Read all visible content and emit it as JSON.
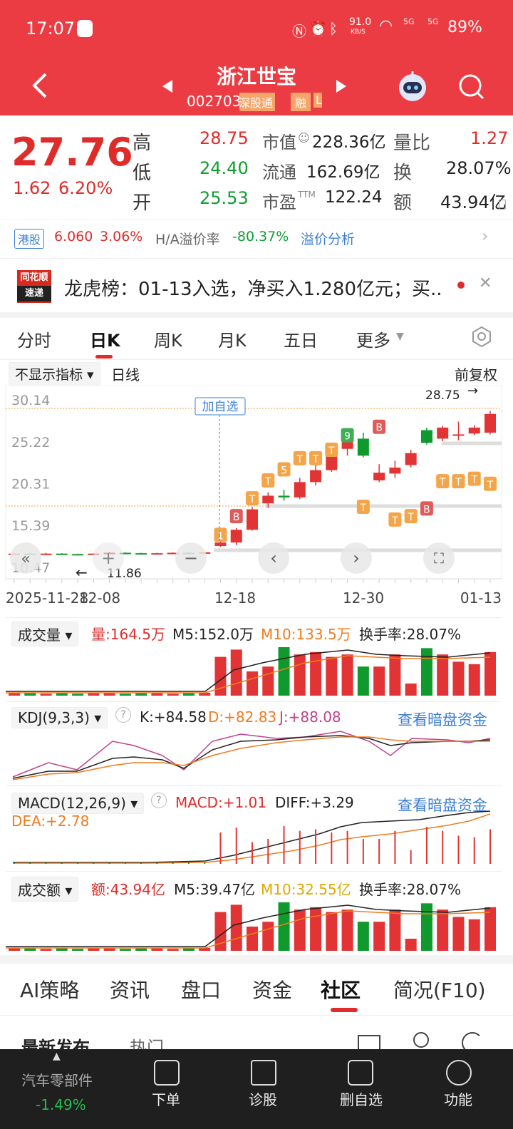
{
  "status": {
    "time": "17:07",
    "speed": "91.0",
    "speed_unit": "KB/S",
    "signal1": "5G",
    "signal2": "5G",
    "battery": "89%"
  },
  "header": {
    "title": "浙江世宝",
    "code": "002703",
    "badge1": "深股通",
    "badge2": "融",
    "badge3": "L"
  },
  "quote": {
    "price": "27.76",
    "change": "1.62",
    "pct": "6.20%",
    "high_label": "高",
    "high": "28.75",
    "low_label": "低",
    "low": "24.40",
    "open_label": "开",
    "open": "25.53",
    "mcap_label": "市值",
    "mcap": "228.36亿",
    "float_label": "流通",
    "float": "162.69亿",
    "pe_label": "市盈",
    "pe_sup": "TTM",
    "pe": "122.24",
    "vr_label": "量比",
    "vr": "1.27",
    "turn_label": "换",
    "turn": "28.07%",
    "amt_label": "额",
    "amt": "43.94亿"
  },
  "hk": {
    "tag": "港股",
    "price": "6.060",
    "pct": "3.06%",
    "premium_label": "H/A溢价率",
    "premium": "-80.37%",
    "link": "溢价分析"
  },
  "news": {
    "logo1": "同花顺",
    "logo2": "速递",
    "text": "龙虎榜：01-13入选，净买入1.280亿元；买..."
  },
  "tabs": [
    "分时",
    "日K",
    "周K",
    "月K",
    "五日",
    "更多"
  ],
  "chart_header": {
    "indicator": "不显示指标",
    "period": "日线",
    "adjust": "前复权"
  },
  "kline": {
    "y_ticks": [
      "30.14",
      "25.22",
      "20.31",
      "15.39",
      "10.47"
    ],
    "x_ticks": [
      "2025-11-28",
      "12-08",
      "12-18",
      "12-30",
      "01-13"
    ],
    "high_mark": "28.75",
    "low_mark": "11.86",
    "add_watch": "加自选"
  },
  "chart_data": {
    "type": "candlestick",
    "candles": [
      {
        "o": 11.9,
        "c": 12.0,
        "h": 12.1,
        "l": 11.9
      },
      {
        "o": 12.0,
        "c": 11.95,
        "h": 12.1,
        "l": 11.86
      },
      {
        "o": 11.95,
        "c": 12.0,
        "h": 12.1,
        "l": 11.9
      },
      {
        "o": 12.0,
        "c": 11.95,
        "h": 12.05,
        "l": 11.9
      },
      {
        "o": 11.95,
        "c": 11.9,
        "h": 12.0,
        "l": 11.86
      },
      {
        "o": 11.9,
        "c": 12.0,
        "h": 12.05,
        "l": 11.9
      },
      {
        "o": 12.0,
        "c": 12.1,
        "h": 12.2,
        "l": 11.95
      },
      {
        "o": 12.1,
        "c": 12.05,
        "h": 12.15,
        "l": 12.0
      },
      {
        "o": 12.05,
        "c": 12.0,
        "h": 12.1,
        "l": 11.95
      },
      {
        "o": 12.0,
        "c": 12.05,
        "h": 12.1,
        "l": 11.95
      },
      {
        "o": 12.05,
        "c": 12.1,
        "h": 12.15,
        "l": 12.0
      },
      {
        "o": 12.1,
        "c": 12.05,
        "h": 12.2,
        "l": 12.0
      },
      {
        "o": 12.05,
        "c": 12.15,
        "h": 12.2,
        "l": 12.0
      },
      {
        "o": 12.9,
        "c": 13.3,
        "h": 13.6,
        "l": 12.8
      },
      {
        "o": 13.3,
        "c": 14.8,
        "h": 15.0,
        "l": 13.0
      },
      {
        "o": 14.8,
        "c": 17.2,
        "h": 17.5,
        "l": 14.7
      },
      {
        "o": 17.9,
        "c": 18.8,
        "h": 19.2,
        "l": 17.4
      },
      {
        "o": 18.8,
        "c": 18.6,
        "h": 19.5,
        "l": 18.2
      },
      {
        "o": 18.6,
        "c": 20.4,
        "h": 20.9,
        "l": 18.4
      },
      {
        "o": 20.4,
        "c": 21.8,
        "h": 22.5,
        "l": 20.0
      },
      {
        "o": 21.8,
        "c": 24.3,
        "h": 24.7,
        "l": 21.6
      },
      {
        "o": 24.3,
        "c": 25.5,
        "h": 26.0,
        "l": 23.5
      },
      {
        "o": 25.5,
        "c": 23.5,
        "h": 26.2,
        "l": 23.3
      },
      {
        "o": 20.6,
        "c": 21.5,
        "h": 22.5,
        "l": 20.4
      },
      {
        "o": 21.4,
        "c": 22.1,
        "h": 22.9,
        "l": 20.9
      },
      {
        "o": 22.4,
        "c": 23.8,
        "h": 24.2,
        "l": 22.1
      },
      {
        "o": 26.5,
        "c": 25.0,
        "h": 26.8,
        "l": 24.8
      },
      {
        "o": 25.5,
        "c": 26.8,
        "h": 27.0,
        "l": 25.2
      },
      {
        "o": 26.0,
        "c": 26.0,
        "h": 27.5,
        "l": 25.3
      },
      {
        "o": 26.1,
        "c": 26.8,
        "h": 27.1,
        "l": 25.9
      },
      {
        "o": 26.2,
        "c": 28.4,
        "h": 28.75,
        "l": 26.0
      }
    ],
    "volume": {
      "value": "164.5万",
      "m5": "M5:152.0万",
      "m10": "M10:133.5万",
      "turnover": "换手率:28.07%",
      "label": "成交量"
    },
    "kdj": {
      "label": "KDJ(9,3,3)",
      "k": "K:+84.58",
      "d": "D:+82.83",
      "j": "J:+88.08",
      "link": "查看暗盘资金"
    },
    "macd": {
      "label": "MACD(12,26,9)",
      "macd": "MACD:+1.01",
      "diff": "DIFF:+3.29",
      "dea": "DEA:+2.78",
      "link": "查看暗盘资金"
    },
    "amount": {
      "label": "成交额",
      "value": "额:43.94亿",
      "m5": "M5:39.47亿",
      "m10": "M10:32.55亿",
      "turnover": "换手率:28.07%"
    }
  },
  "bottom_tabs": [
    "AI策略",
    "资讯",
    "盘口",
    "资金",
    "社区",
    "简况(F10)"
  ],
  "community": {
    "latest": "最新发布",
    "hot": "热门"
  },
  "footer": {
    "sector": "汽车零部件",
    "sector_pct": "-1.49%",
    "items": [
      "下单",
      "诊股",
      "删自选",
      "功能"
    ]
  }
}
